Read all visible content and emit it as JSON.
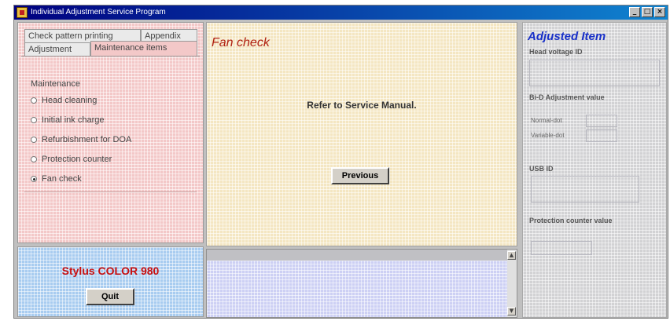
{
  "window": {
    "title": "Individual Adjustment Service Program",
    "minimize": "_",
    "maximize": "□",
    "close": "×"
  },
  "tabs": {
    "row1": [
      "Check pattern printing",
      "Appendix"
    ],
    "row2": [
      "Adjustment",
      "Maintenance items"
    ],
    "active": "Maintenance items"
  },
  "maintenance": {
    "group_label": "Maintenance",
    "options": [
      {
        "label": "Head cleaning",
        "checked": false
      },
      {
        "label": "Initial ink charge",
        "checked": false
      },
      {
        "label": "Refurbishment for DOA",
        "checked": false
      },
      {
        "label": "Protection counter",
        "checked": false
      },
      {
        "label": "Fan check",
        "checked": true
      }
    ]
  },
  "printer": {
    "model": "Stylus COLOR 980",
    "quit_label": "Quit"
  },
  "main": {
    "title": "Fan check",
    "message": "Refer to Service Manual.",
    "previous_label": "Previous"
  },
  "log": {
    "scroll_up": "▲",
    "scroll_down": "▼"
  },
  "adjusted": {
    "heading": "Adjusted Item",
    "head_voltage_label": "Head voltage ID",
    "head_voltage_value": "",
    "bi_d_label": "Bi-D Adjustment value",
    "normal_dot_label": "Normal-dot",
    "normal_dot_value": "",
    "variable_dot_label": "Variable-dot",
    "variable_dot_value": "",
    "usb_id_label": "USB ID",
    "usb_id_value": "",
    "protection_label": "Protection counter value",
    "protection_value": ""
  },
  "colors": {
    "title_bar": "#000080",
    "model_text": "#c81010",
    "main_title": "#b02010",
    "adjusted_heading": "#1830c8"
  }
}
